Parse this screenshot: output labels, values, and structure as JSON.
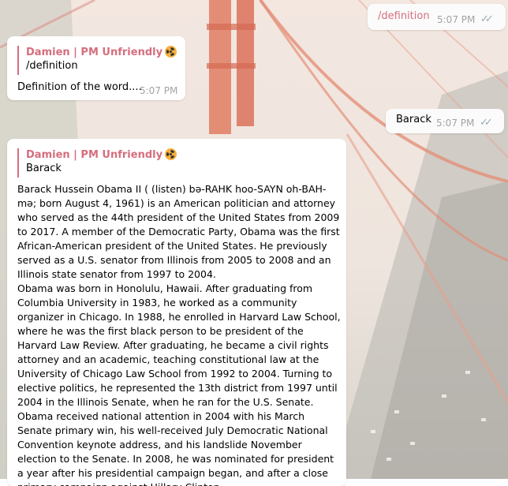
{
  "messages": {
    "m1": {
      "text": "/definition",
      "time": "5:07 PM",
      "status": "read"
    },
    "m2": {
      "reply_name": "Damien | PM Unfriendly",
      "reply_text": "/definition",
      "text": "Definition of the word....",
      "time": "5:07 PM"
    },
    "m3": {
      "text": "Barack",
      "time": "5:07 PM",
      "status": "read"
    },
    "m4": {
      "reply_name": "Damien | PM Unfriendly",
      "reply_text": "Barack",
      "paragraph1": "Barack Hussein Obama II ( (listen) bə-RAHK hoo-SAYN oh-BAH-mə; born August 4, 1961) is an American politician and attorney who served as the 44th president of the United States from 2009 to 2017. A member of the Democratic Party, Obama was the first African-American president of the United States. He previously served as a U.S. senator from Illinois from 2005 to 2008 and an Illinois state senator from 1997 to 2004.",
      "paragraph2": "Obama was born in Honolulu, Hawaii. After graduating from Columbia University in 1983, he worked as a community organizer in Chicago. In 1988, he enrolled in Harvard Law School, where he was the first black person to be president of the Harvard Law Review. After graduating, he became a civil rights attorney and an academic, teaching constitutional law at the University of Chicago Law School from 1992 to 2004. Turning to elective politics, he represented the 13th district from 1997 until 2004 in the Illinois Senate, when he ran for the U.S. Senate. Obama received national attention in 2004 with his March Senate primary win, his well-received July Democratic National Convention keynote address, and his landslide November election to the Senate. In 2008, he was nominated for president a year after his presidential campaign began, and after a close primary campaign against Hillary Clinton"
    }
  },
  "colors": {
    "accent": "#d56e7d",
    "check": "#9aaab4",
    "time": "#a3a3a3"
  },
  "icons": {
    "badge": "radioactive-icon",
    "read_status": "double-check-icon"
  }
}
